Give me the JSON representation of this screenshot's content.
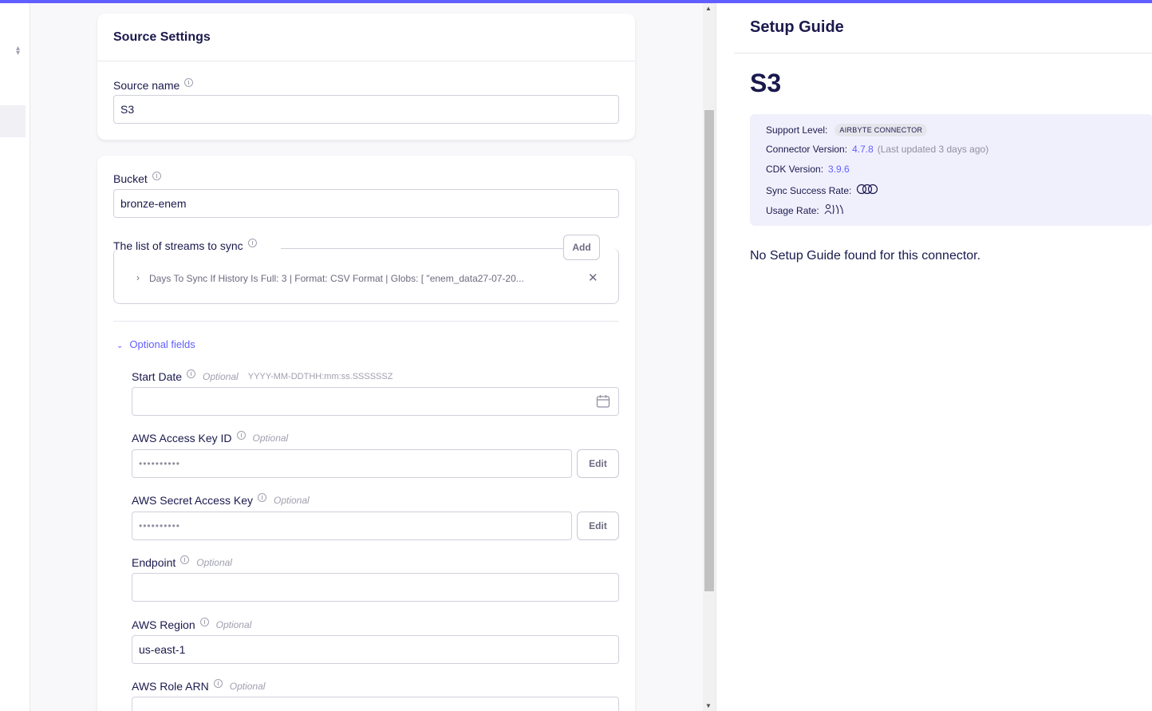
{
  "source_settings": {
    "title": "Source Settings",
    "source_name_label": "Source name",
    "source_name_value": "S3"
  },
  "bucket": {
    "label": "Bucket",
    "value": "bronze-enem"
  },
  "streams": {
    "label": "The list of streams to sync",
    "add_label": "Add",
    "items": [
      {
        "summary": "Days To Sync If History Is Full: 3 | Format: CSV Format | Globs: [ \"enem_data27-07-20..."
      }
    ]
  },
  "optional_fields": {
    "toggle_label": "Optional fields",
    "optional_tag": "Optional",
    "start_date": {
      "label": "Start Date",
      "hint": "YYYY-MM-DDTHH:mm:ss.SSSSSSZ",
      "value": ""
    },
    "aws_access_key_id": {
      "label": "AWS Access Key ID",
      "value": "••••••••••",
      "edit_label": "Edit"
    },
    "aws_secret_access_key": {
      "label": "AWS Secret Access Key",
      "value": "••••••••••",
      "edit_label": "Edit"
    },
    "endpoint": {
      "label": "Endpoint",
      "value": ""
    },
    "aws_region": {
      "label": "AWS Region",
      "value": "us-east-1"
    },
    "aws_role_arn": {
      "label": "AWS Role ARN",
      "value": ""
    }
  },
  "setup_guide": {
    "title": "Setup Guide",
    "connector_name": "S3",
    "support_level_label": "Support Level:",
    "support_level_value": "AIRBYTE CONNECTOR",
    "connector_version_label": "Connector Version:",
    "connector_version_value": "4.7.8",
    "connector_version_updated": "(Last updated 3 days ago)",
    "cdk_version_label": "CDK Version:",
    "cdk_version_value": "3.9.6",
    "sync_success_rate_label": "Sync Success Rate:",
    "usage_rate_label": "Usage Rate:",
    "no_guide_text": "No Setup Guide found for this connector."
  },
  "colors": {
    "accent": "#615eff",
    "text": "#1a194d",
    "muted": "#a0a0b0"
  }
}
